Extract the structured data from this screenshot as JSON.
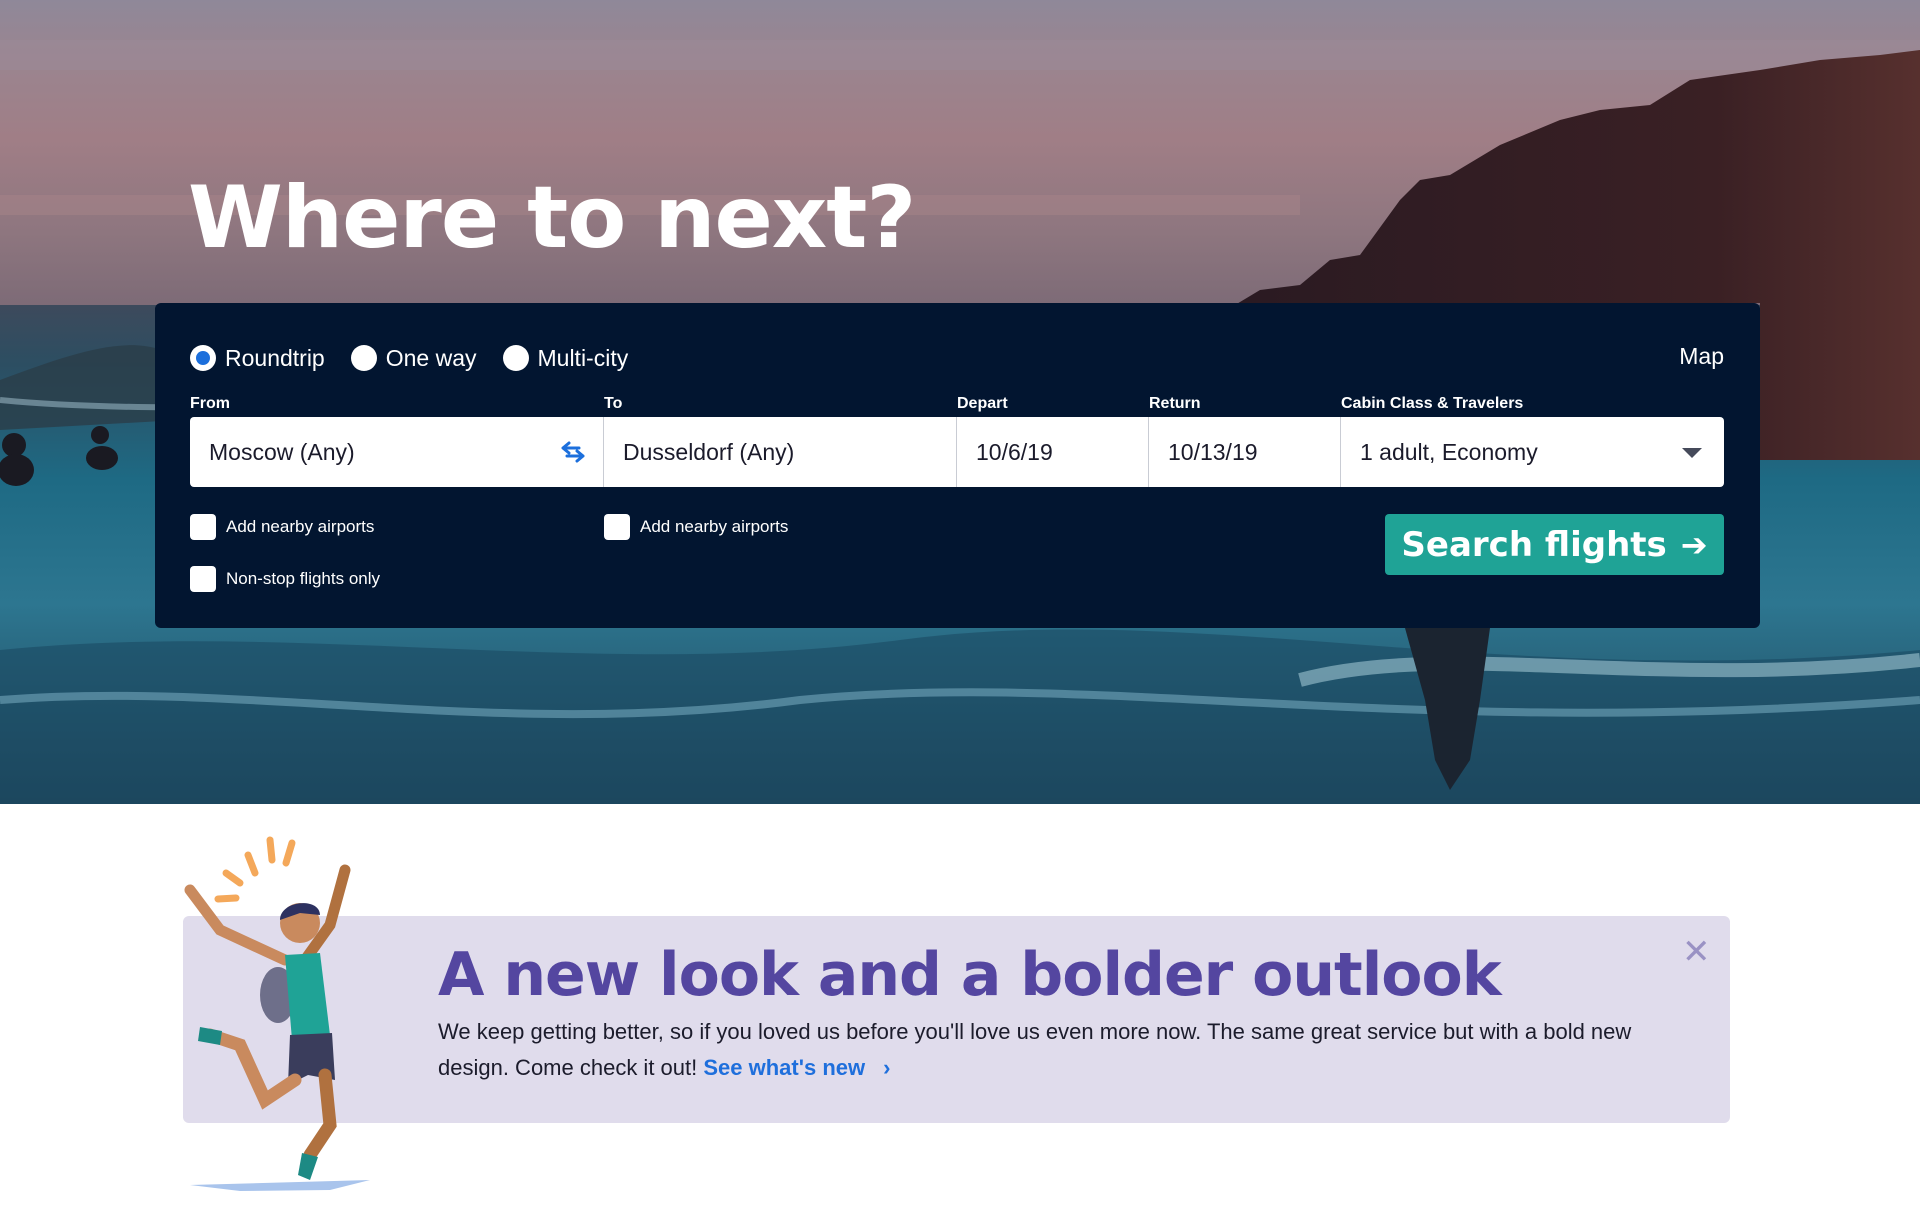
{
  "hero": {
    "title": "Where to next?"
  },
  "search": {
    "trip_types": [
      {
        "label": "Roundtrip",
        "selected": true
      },
      {
        "label": "One way",
        "selected": false
      },
      {
        "label": "Multi-city",
        "selected": false
      }
    ],
    "map_label": "Map",
    "fields": {
      "from": {
        "label": "From",
        "value": "Moscow (Any)"
      },
      "to": {
        "label": "To",
        "value": "Dusseldorf (Any)"
      },
      "depart": {
        "label": "Depart",
        "value": "10/6/19"
      },
      "return": {
        "label": "Return",
        "value": "10/13/19"
      },
      "cabin": {
        "label": "Cabin Class & Travelers",
        "value": "1 adult, Economy"
      }
    },
    "options": {
      "from_nearby": {
        "label": "Add nearby airports",
        "checked": false
      },
      "to_nearby": {
        "label": "Add nearby airports",
        "checked": false
      },
      "nonstop": {
        "label": "Non-stop flights only",
        "checked": false
      }
    },
    "search_button": {
      "label": "Search flights",
      "icon": "arrow-right-icon"
    },
    "swap_icon": "swap-icon",
    "dropdown_icon": "caret-down-icon"
  },
  "banner": {
    "title": "A new look and a bolder outlook",
    "text": "We keep getting better, so if you loved us before you'll love us even more now. The same great service but with a bold new design. Come check it out!",
    "link_label": "See what's new",
    "link_icon": "chevron-right-icon",
    "close_icon": "close-icon"
  },
  "colors": {
    "panel": "#021530",
    "accent_teal": "#1fa396",
    "accent_blue": "#1c6fdc",
    "banner_bg": "#e0dcec",
    "banner_title": "#5446a0"
  }
}
